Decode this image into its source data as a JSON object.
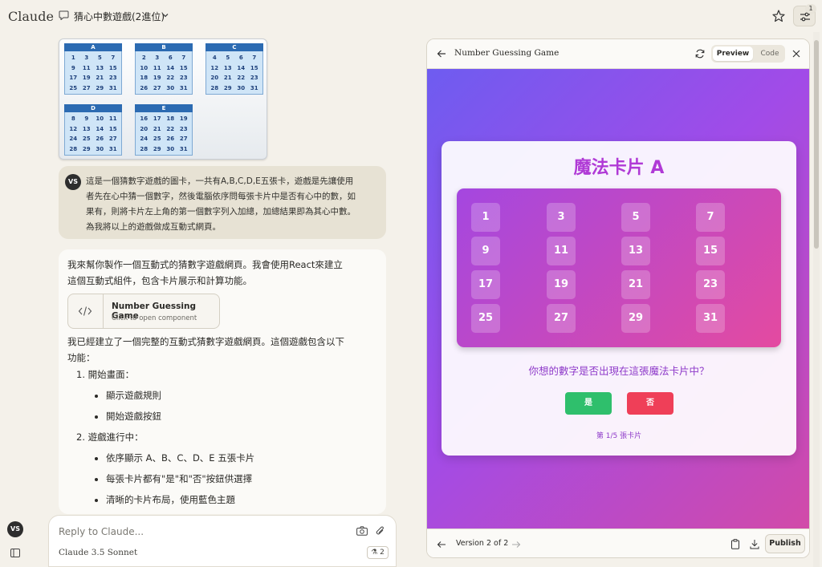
{
  "app": {
    "brand": "Claude"
  },
  "header": {
    "conversation_title": "猜心中數遊戲(2進位)",
    "settings_badge": "1"
  },
  "user": {
    "initials": "VS"
  },
  "attachment": {
    "cards": [
      {
        "label": "A",
        "numbers": [
          "1",
          "3",
          "5",
          "7",
          "9",
          "11",
          "13",
          "15",
          "17",
          "19",
          "21",
          "23",
          "25",
          "27",
          "29",
          "31"
        ]
      },
      {
        "label": "B",
        "numbers": [
          "2",
          "3",
          "6",
          "7",
          "10",
          "11",
          "14",
          "15",
          "18",
          "19",
          "22",
          "23",
          "26",
          "27",
          "30",
          "31"
        ]
      },
      {
        "label": "C",
        "numbers": [
          "4",
          "5",
          "6",
          "7",
          "12",
          "13",
          "14",
          "15",
          "20",
          "21",
          "22",
          "23",
          "28",
          "29",
          "30",
          "31"
        ]
      },
      {
        "label": "D",
        "numbers": [
          "8",
          "9",
          "10",
          "11",
          "12",
          "13",
          "14",
          "15",
          "24",
          "25",
          "26",
          "27",
          "28",
          "29",
          "30",
          "31"
        ]
      },
      {
        "label": "E",
        "numbers": [
          "16",
          "17",
          "18",
          "19",
          "20",
          "21",
          "22",
          "23",
          "24",
          "25",
          "26",
          "27",
          "28",
          "29",
          "30",
          "31"
        ]
      }
    ]
  },
  "user_message": {
    "lines": [
      "這是一個猜數字遊戲的圖卡，一共有A,B,C,D,E五張卡，遊戲是先讓使用",
      "者先在心中猜一個數字，然後電腦依序問每張卡片中是否有心中的數，如",
      "果有，則將卡片左上角的第一個數字列入加總，加總結果即為其心中數。",
      "為我將以上的遊戲做成互動式網頁。"
    ]
  },
  "assistant": {
    "intro_lines": [
      "我來幫你製作一個互動式的猜數字遊戲網頁。我會使用React來建立",
      "這個互動式組件，包含卡片展示和計算功能。"
    ],
    "component_card": {
      "title": "Number Guessing Game",
      "subtitle": "Click to open component"
    },
    "para2_lines": [
      "我已經建立了一個完整的互動式猜數字遊戲網頁。這個遊戲包含以下",
      "功能："
    ],
    "list": [
      {
        "type": "num",
        "text": "1. 開始畫面："
      },
      {
        "type": "bullet",
        "text": "顯示遊戲規則"
      },
      {
        "type": "bullet",
        "text": "開始遊戲按鈕"
      },
      {
        "type": "num",
        "text": "2. 遊戲進行中："
      },
      {
        "type": "bullet",
        "text": "依序顯示 A、B、C、D、E 五張卡片"
      },
      {
        "type": "bullet",
        "text": "每張卡片都有\"是\"和\"否\"按鈕供選擇"
      },
      {
        "type": "bullet",
        "text": "清晰的卡片布局，使用藍色主題"
      }
    ]
  },
  "reply": {
    "placeholder": "Reply to Claude...",
    "model": "Claude 3.5 Sonnet",
    "attachments_count": "2"
  },
  "artifact": {
    "title": "Number Guessing Game",
    "preview_label": "Preview",
    "code_label": "Code",
    "card_title": "魔法卡片 A",
    "numbers": [
      "1",
      "3",
      "5",
      "7",
      "9",
      "11",
      "13",
      "15",
      "17",
      "19",
      "21",
      "23",
      "25",
      "27",
      "29",
      "31"
    ],
    "question": "你想的數字是否出現在這張魔法卡片中？",
    "yes_label": "是",
    "no_label": "否",
    "progress": "第 1/5 張卡片",
    "version": "Version 2 of 2",
    "publish_label": "Publish"
  }
}
